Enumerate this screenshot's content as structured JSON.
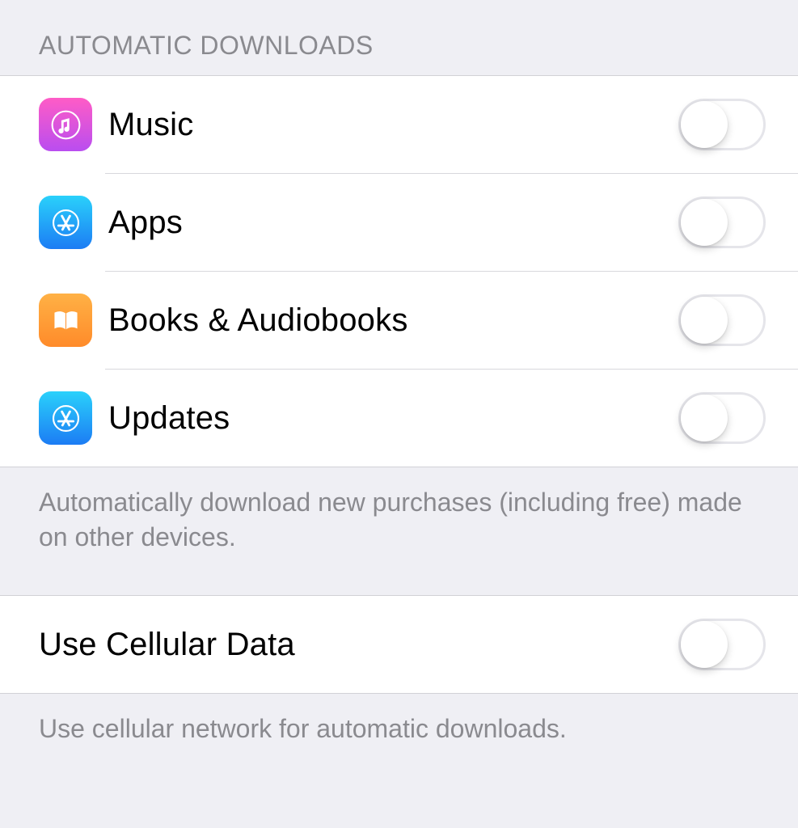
{
  "section1": {
    "header": "Automatic Downloads",
    "rows": [
      {
        "label": "Music",
        "enabled": false
      },
      {
        "label": "Apps",
        "enabled": false
      },
      {
        "label": "Books & Audiobooks",
        "enabled": false
      },
      {
        "label": "Updates",
        "enabled": false
      }
    ],
    "footer": "Automatically download new purchases (including free) made on other devices."
  },
  "section2": {
    "row": {
      "label": "Use Cellular Data",
      "enabled": false
    },
    "footer": "Use cellular network for automatic downloads."
  }
}
